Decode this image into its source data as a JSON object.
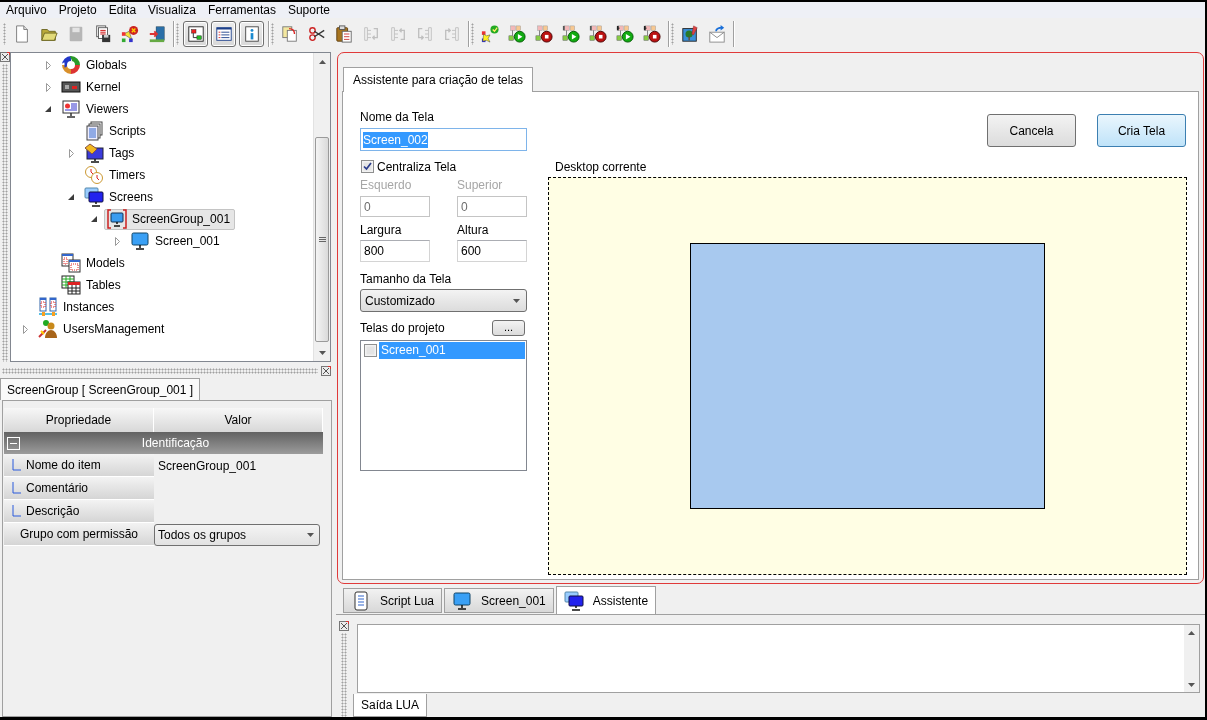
{
  "menu_bar": [
    "Arquivo",
    "Projeto",
    "Edita",
    "Visualiza",
    "Ferramentas",
    "Suporte"
  ],
  "toolbar": [
    [
      {
        "kind": "new",
        "disabled": false,
        "pressed": false
      },
      {
        "kind": "open",
        "disabled": false,
        "pressed": false
      },
      {
        "kind": "save",
        "disabled": true,
        "pressed": false
      },
      {
        "kind": "print",
        "disabled": false,
        "pressed": false
      },
      {
        "kind": "remove",
        "disabled": false,
        "pressed": false
      },
      {
        "kind": "exit",
        "disabled": false,
        "pressed": false
      }
    ],
    [
      {
        "kind": "tree",
        "disabled": false,
        "pressed": true
      },
      {
        "kind": "list",
        "disabled": false,
        "pressed": true
      },
      {
        "kind": "info",
        "disabled": false,
        "pressed": true
      }
    ],
    [
      {
        "kind": "copy",
        "disabled": false,
        "pressed": false
      },
      {
        "kind": "cut",
        "disabled": false,
        "pressed": false
      },
      {
        "kind": "paste",
        "disabled": false,
        "pressed": false
      },
      {
        "kind": "raise",
        "disabled": true,
        "pressed": false
      },
      {
        "kind": "lower",
        "disabled": true,
        "pressed": false
      },
      {
        "kind": "first",
        "disabled": true,
        "pressed": false
      },
      {
        "kind": "last",
        "disabled": true,
        "pressed": false
      }
    ],
    [
      {
        "kind": "validate",
        "disabled": false,
        "pressed": false
      },
      {
        "kind": "run",
        "disabled": false,
        "pressed": false
      },
      {
        "kind": "stop",
        "disabled": false,
        "pressed": false
      },
      {
        "kind": "vrun",
        "disabled": false,
        "pressed": false
      },
      {
        "kind": "vstop",
        "disabled": false,
        "pressed": false
      },
      {
        "kind": "krun",
        "disabled": false,
        "pressed": false
      },
      {
        "kind": "kstop",
        "disabled": false,
        "pressed": false
      }
    ],
    [
      {
        "kind": "image",
        "disabled": false,
        "pressed": false
      },
      {
        "kind": "mail",
        "disabled": false,
        "pressed": false
      }
    ]
  ],
  "project_tree": [
    {
      "children": [
        {
          "label": "Globals",
          "kind": "ring",
          "expanded": false,
          "selected": false
        },
        {
          "label": "Kernel",
          "kind": "device",
          "expanded": false,
          "selected": false
        },
        {
          "label": "Viewers",
          "kind": "viewer",
          "expanded": true,
          "selected": false,
          "children": [
            {
              "label": "Scripts",
              "kind": "pages",
              "selected": false
            },
            {
              "label": "Tags",
              "kind": "tags",
              "expanded": false,
              "selected": false
            },
            {
              "label": "Timers",
              "kind": "timers",
              "selected": false
            },
            {
              "label": "Screens",
              "kind": "screens",
              "expanded": true,
              "selected": false,
              "children": [
                {
                  "label": "ScreenGroup_001",
                  "kind": "group",
                  "expanded": true,
                  "selected": true,
                  "children": [
                    {
                      "label": "Screen_001",
                      "kind": "screen",
                      "expanded": false,
                      "selected": false
                    }
                  ]
                }
              ]
            }
          ]
        },
        {
          "label": "Models",
          "kind": "models",
          "selected": false
        },
        {
          "label": "Tables",
          "kind": "tables",
          "selected": false
        }
      ]
    },
    {
      "label": "Instances",
      "kind": "instances",
      "selected": false
    },
    {
      "label": "UsersManagement",
      "kind": "users",
      "expanded": false,
      "selected": false
    }
  ],
  "properties": {
    "tab": "ScreenGroup [ ScreenGroup_001 ]",
    "columns": [
      "Propriedade",
      "Valor"
    ],
    "categories": [
      {
        "label": "Identificação",
        "expanded": true,
        "rows": [
          {
            "label": "Nome do item",
            "kind": "text",
            "value": "ScreenGroup_001"
          },
          {
            "label": "Comentário",
            "kind": "text"
          },
          {
            "label": "Descrição",
            "kind": "text"
          }
        ]
      }
    ],
    "rows": [
      {
        "label": "Grupo com permissão",
        "kind": "dropdown",
        "value": "Todos os grupos"
      }
    ]
  },
  "wizard": {
    "tab": "Assistente para criação de telas",
    "name_field": {
      "label": "Nome da Tela",
      "value": "Screen_002",
      "value_selected": true
    },
    "center_checkbox": {
      "label": "Centraliza Tela",
      "checked": true
    },
    "dimension_fields": [
      {
        "label": "Esquerdo",
        "value": "0",
        "disabled": true
      },
      {
        "label": "Superior",
        "value": "0",
        "disabled": true
      },
      {
        "label": "Largura",
        "value": "800",
        "disabled": false
      },
      {
        "label": "Altura",
        "value": "600",
        "disabled": false
      }
    ],
    "size_select": {
      "label": "Tamanho da Tela",
      "value": "Customizado"
    },
    "project_screens": {
      "label": "Telas do projeto",
      "browse_button": "...",
      "items": [
        {
          "label": "Screen_001",
          "checked": false,
          "selected": true
        }
      ]
    },
    "buttons": [
      {
        "label": "Cancela",
        "default": false
      },
      {
        "label": "Cria Tela",
        "default": true
      }
    ],
    "preview": {
      "label": "Desktop corrente"
    }
  },
  "document_tabs": [
    {
      "label": "Script Lua",
      "kind": "script",
      "selected": false
    },
    {
      "label": "Screen_001",
      "kind": "screen",
      "selected": false
    },
    {
      "label": "Assistente",
      "kind": "wizard",
      "selected": true
    }
  ],
  "output_panel": {
    "tab": "Saída LUA"
  }
}
